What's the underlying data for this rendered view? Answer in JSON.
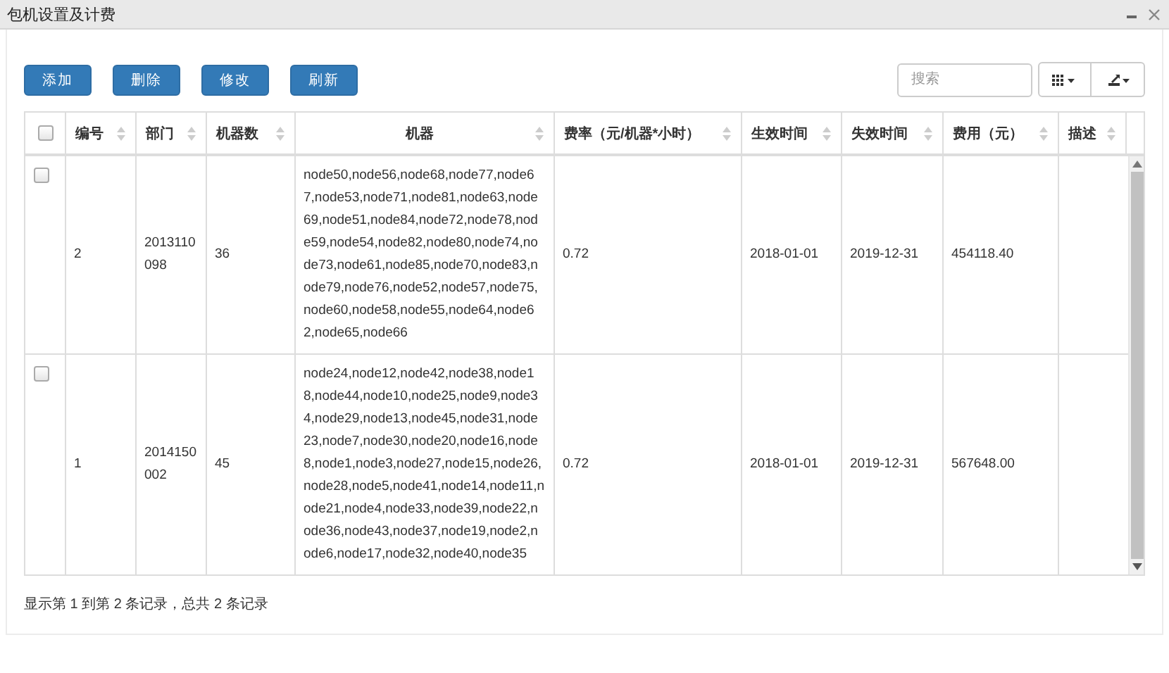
{
  "window": {
    "title": "包机设置及计费"
  },
  "toolbar": {
    "buttons": [
      "添加",
      "删除",
      "修改",
      "刷新"
    ],
    "search": {
      "placeholder": "搜索"
    }
  },
  "table": {
    "header_checkbox": {
      "checked": false
    },
    "columns": [
      {
        "label": "编号",
        "sortable": true
      },
      {
        "label": "部门",
        "sortable": true
      },
      {
        "label": "机器数",
        "sortable": true
      },
      {
        "label": "机器",
        "sortable": true
      },
      {
        "label": "费率（元/机器*小时）",
        "sortable": true
      },
      {
        "label": "生效时间",
        "sortable": true
      },
      {
        "label": "失效时间",
        "sortable": true
      },
      {
        "label": "费用（元）",
        "sortable": true
      },
      {
        "label": "描述",
        "sortable": true
      }
    ],
    "rows": [
      {
        "checked": false,
        "cells": [
          "2",
          "2013110098",
          "36",
          "node50,node56,node68,node77,node67,node53,node71,node81,node63,node69,node51,node84,node72,node78,node59,node54,node82,node80,node74,node73,node61,node85,node70,node83,node79,node76,node52,node57,node75,node60,node58,node55,node64,node62,node65,node66",
          "0.72",
          "2018-01-01",
          "2019-12-31",
          "454118.40",
          ""
        ]
      },
      {
        "checked": false,
        "cells": [
          "1",
          "2014150002",
          "45",
          "node24,node12,node42,node38,node18,node44,node10,node25,node9,node34,node29,node13,node45,node31,node23,node7,node30,node20,node16,node8,node1,node3,node27,node15,node26,node28,node5,node41,node14,node11,node21,node4,node33,node39,node22,node36,node43,node37,node19,node2,node6,node17,node32,node40,node35",
          "0.72",
          "2018-01-01",
          "2019-12-31",
          "567648.00",
          ""
        ]
      }
    ]
  },
  "footer": {
    "summary": "显示第 1 到第 2 条记录，总共 2 条记录"
  }
}
